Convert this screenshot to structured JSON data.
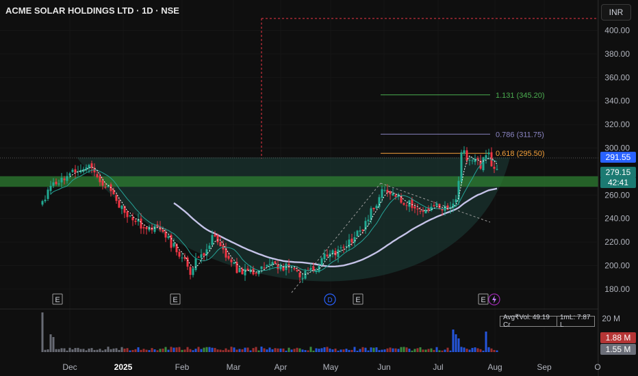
{
  "header": {
    "title": "ACME SOLAR HOLDINGS LTD · 1D · NSE",
    "currency_button": "INR"
  },
  "badges": {
    "current_price": "291.55",
    "ma_value": "279.15",
    "countdown": "42:41",
    "volume_red": "1.88 M",
    "volume_grey": "1.55 M"
  },
  "volume_info": {
    "avg_vol": "Avg₹Vol: 49.19 Cr",
    "lot": "1mL: 7.87 L"
  },
  "markers": {
    "earnings_label": "E",
    "dividend_label": "D"
  },
  "colors": {
    "up": "#22ab94",
    "down": "#f23645",
    "background": "#0f0f0f",
    "fib_1131": "#4caf50",
    "fib_0786": "#8c86c4",
    "fib_0618": "#f5a03a",
    "support_zone": "#2e7d32",
    "cup_fill": "#1b3a36",
    "ma_short": "#26a69a",
    "ma_long": "#c5c3e8",
    "price_badge": "#2962ff",
    "ma_badge": "#1c7a72",
    "vol_red_badge": "#b53535",
    "vol_grey_badge": "#6b6e78"
  },
  "chart_data": {
    "type": "candlestick",
    "y_axis": {
      "ticks": [
        "400.00",
        "380.00",
        "360.00",
        "340.00",
        "320.00",
        "300.00",
        "260.00",
        "240.00",
        "220.00",
        "200.00",
        "180.00"
      ],
      "ylim": [
        165,
        412
      ],
      "volume_tick": "20 M"
    },
    "x_axis": {
      "ticks": [
        "Dec",
        "2025",
        "Feb",
        "Mar",
        "Apr",
        "May",
        "Jun",
        "Jul",
        "Aug",
        "Sep",
        "O"
      ]
    },
    "price_path": [
      [
        0,
        255
      ],
      [
        3,
        266
      ],
      [
        7,
        271
      ],
      [
        12,
        282
      ],
      [
        16,
        286
      ],
      [
        20,
        275
      ],
      [
        25,
        262
      ],
      [
        30,
        247
      ],
      [
        35,
        236
      ],
      [
        40,
        232
      ],
      [
        45,
        224
      ],
      [
        50,
        210
      ],
      [
        54,
        196
      ],
      [
        58,
        208
      ],
      [
        63,
        226
      ],
      [
        67,
        210
      ],
      [
        71,
        196
      ],
      [
        75,
        194
      ],
      [
        79,
        198
      ],
      [
        83,
        203
      ],
      [
        87,
        199
      ],
      [
        92,
        196
      ],
      [
        95,
        193
      ],
      [
        99,
        196
      ],
      [
        104,
        209
      ],
      [
        109,
        212
      ],
      [
        114,
        223
      ],
      [
        118,
        235
      ],
      [
        121,
        250
      ],
      [
        125,
        266
      ],
      [
        130,
        257
      ],
      [
        135,
        252
      ],
      [
        140,
        248
      ],
      [
        145,
        250
      ],
      [
        148,
        249
      ],
      [
        151,
        255
      ],
      [
        153,
        297
      ],
      [
        157,
        288
      ],
      [
        160,
        286
      ],
      [
        163,
        293
      ],
      [
        166,
        279
      ]
    ],
    "fib_levels": [
      {
        "ratio": "1.131",
        "price": 345.2,
        "label": "1.131 (345.20)"
      },
      {
        "ratio": "0.786",
        "price": 311.75,
        "label": "0.786 (311.75)"
      },
      {
        "ratio": "0.618",
        "price": 295.5,
        "label": "0.618 (295.50)"
      }
    ],
    "support_zone": [
      267,
      276
    ],
    "cup_rim_price": 292,
    "current_price": 291.55,
    "ma_value": 279.15
  }
}
